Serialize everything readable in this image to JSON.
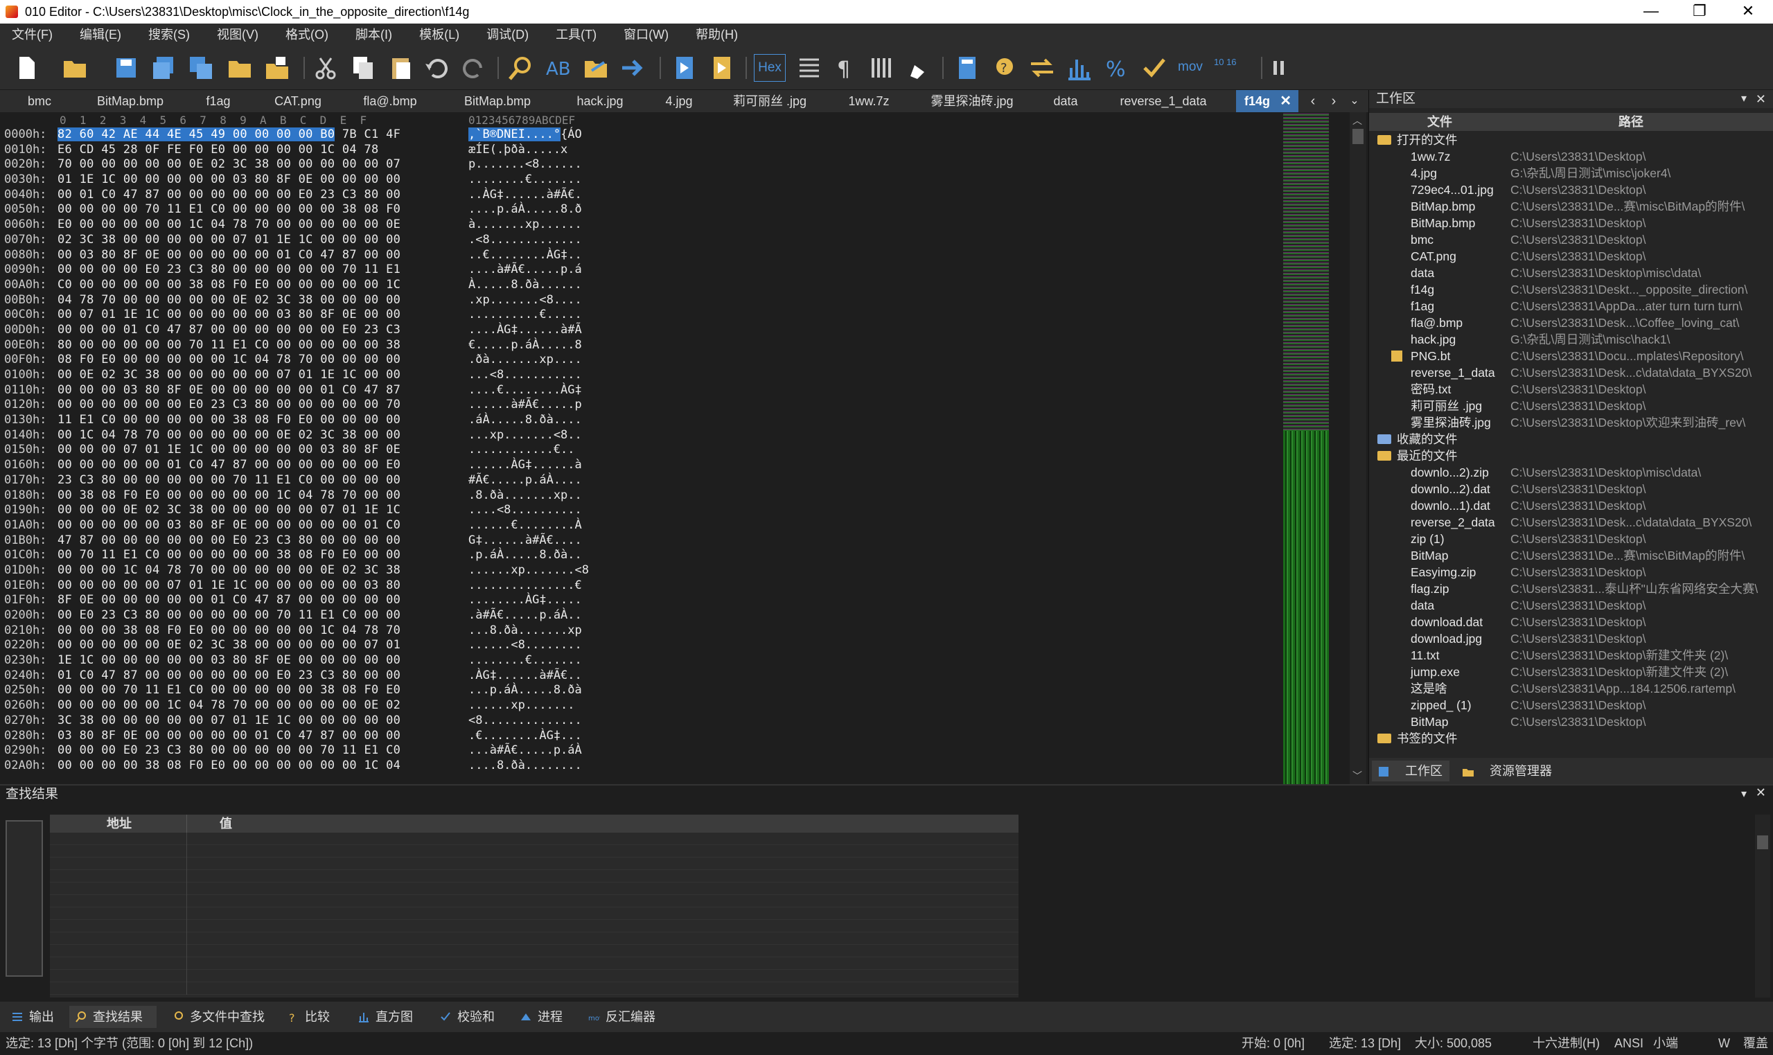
{
  "window": {
    "title": "010 Editor - C:\\Users\\23831\\Desktop\\misc\\Clock_in_the_opposite_direction\\f14g",
    "minimize": "—",
    "maximize": "❐",
    "close": "✕"
  },
  "menu": [
    "文件(F)",
    "编辑(E)",
    "搜索(S)",
    "视图(V)",
    "格式(O)",
    "脚本(I)",
    "模板(L)",
    "调试(D)",
    "工具(T)",
    "窗口(W)",
    "帮助(H)"
  ],
  "toolbar": {
    "hex_label": "Hex",
    "mov_label": "mov",
    "base_label": "10 16"
  },
  "tabs": [
    "bmc",
    "BitMap.bmp",
    "f1ag",
    "CAT.png",
    "fla@.bmp",
    "BitMap.bmp",
    "hack.jpg",
    "4.jpg",
    "莉可丽丝 .jpg",
    "1ww.7z",
    "雾里探油砖.jpg",
    "data",
    "reverse_1_data",
    "f14g"
  ],
  "active_tab": "f14g",
  "hex_header": {
    "cols": "0  1  2  3  4  5  6  7  8  9  A  B  C  D  E  F",
    "ascii": "0123456789ABCDEF"
  },
  "hex_rows": [
    {
      "a": "0000h:",
      "b": "82 60 42 AE 44 4E 45 49 00 00 00 00 B0 7B C1 4F",
      "t": "‚`B®DNEI....°{ÁO"
    },
    {
      "a": "0010h:",
      "b": "E6 CD 45 28 0F FE F0 E0 00 00 00 00 1C 04 78",
      "t": "æÍE(.þðà.....x"
    },
    {
      "a": "0020h:",
      "b": "70 00 00 00 00 00 0E 02 3C 38 00 00 00 00 00 07",
      "t": "p.......<8......"
    },
    {
      "a": "0030h:",
      "b": "01 1E 1C 00 00 00 00 00 03 80 8F 0E 00 00 00 00",
      "t": "........€......."
    },
    {
      "a": "0040h:",
      "b": "00 01 C0 47 87 00 00 00 00 00 00 E0 23 C3 80 00",
      "t": "..ÀG‡......à#Ã€."
    },
    {
      "a": "0050h:",
      "b": "00 00 00 00 70 11 E1 C0 00 00 00 00 00 38 08 F0",
      "t": "....p.áÀ.....8.ð"
    },
    {
      "a": "0060h:",
      "b": "E0 00 00 00 00 00 1C 04 78 70 00 00 00 00 00 0E",
      "t": "à.......xp......"
    },
    {
      "a": "0070h:",
      "b": "02 3C 38 00 00 00 00 00 07 01 1E 1C 00 00 00 00",
      "t": ".<8............."
    },
    {
      "a": "0080h:",
      "b": "00 03 80 8F 0E 00 00 00 00 00 01 C0 47 87 00 00",
      "t": "..€........ÀG‡.."
    },
    {
      "a": "0090h:",
      "b": "00 00 00 00 E0 23 C3 80 00 00 00 00 00 70 11 E1",
      "t": "....à#Ã€.....p.á"
    },
    {
      "a": "00A0h:",
      "b": "C0 00 00 00 00 00 38 08 F0 E0 00 00 00 00 00 1C",
      "t": "À.....8.ðà......"
    },
    {
      "a": "00B0h:",
      "b": "04 78 70 00 00 00 00 00 0E 02 3C 38 00 00 00 00",
      "t": ".xp.......<8...."
    },
    {
      "a": "00C0h:",
      "b": "00 07 01 1E 1C 00 00 00 00 00 03 80 8F 0E 00 00",
      "t": "..........€....."
    },
    {
      "a": "00D0h:",
      "b": "00 00 00 01 C0 47 87 00 00 00 00 00 00 E0 23 C3",
      "t": "....ÀG‡......à#Ã"
    },
    {
      "a": "00E0h:",
      "b": "80 00 00 00 00 00 70 11 E1 C0 00 00 00 00 00 38",
      "t": "€.....p.áÀ.....8"
    },
    {
      "a": "00F0h:",
      "b": "08 F0 E0 00 00 00 00 00 1C 04 78 70 00 00 00 00",
      "t": ".ðà.......xp...."
    },
    {
      "a": "0100h:",
      "b": "00 0E 02 3C 38 00 00 00 00 00 07 01 1E 1C 00 00",
      "t": "...<8..........."
    },
    {
      "a": "0110h:",
      "b": "00 00 00 03 80 8F 0E 00 00 00 00 00 01 C0 47 87",
      "t": "....€........ÀG‡"
    },
    {
      "a": "0120h:",
      "b": "00 00 00 00 00 00 E0 23 C3 80 00 00 00 00 00 70",
      "t": "......à#Ã€.....p"
    },
    {
      "a": "0130h:",
      "b": "11 E1 C0 00 00 00 00 00 38 08 F0 E0 00 00 00 00",
      "t": ".áÀ.....8.ðà...."
    },
    {
      "a": "0140h:",
      "b": "00 1C 04 78 70 00 00 00 00 00 0E 02 3C 38 00 00",
      "t": "...xp.......<8.."
    },
    {
      "a": "0150h:",
      "b": "00 00 00 07 01 1E 1C 00 00 00 00 00 03 80 8F 0E",
      "t": "............€.."
    },
    {
      "a": "0160h:",
      "b": "00 00 00 00 00 01 C0 47 87 00 00 00 00 00 00 E0",
      "t": "......ÀG‡......à"
    },
    {
      "a": "0170h:",
      "b": "23 C3 80 00 00 00 00 00 70 11 E1 C0 00 00 00 00",
      "t": "#Ã€.....p.áÀ...."
    },
    {
      "a": "0180h:",
      "b": "00 38 08 F0 E0 00 00 00 00 00 1C 04 78 70 00 00",
      "t": ".8.ðà.......xp.."
    },
    {
      "a": "0190h:",
      "b": "00 00 00 0E 02 3C 38 00 00 00 00 00 07 01 1E 1C",
      "t": "....<8.........."
    },
    {
      "a": "01A0h:",
      "b": "00 00 00 00 00 03 80 8F 0E 00 00 00 00 00 01 C0",
      "t": "......€........À"
    },
    {
      "a": "01B0h:",
      "b": "47 87 00 00 00 00 00 00 E0 23 C3 80 00 00 00 00",
      "t": "G‡......à#Ã€...."
    },
    {
      "a": "01C0h:",
      "b": "00 70 11 E1 C0 00 00 00 00 00 38 08 F0 E0 00 00",
      "t": ".p.áÀ.....8.ðà.."
    },
    {
      "a": "01D0h:",
      "b": "00 00 00 1C 04 78 70 00 00 00 00 00 0E 02 3C 38",
      "t": "......xp.......<8"
    },
    {
      "a": "01E0h:",
      "b": "00 00 00 00 00 07 01 1E 1C 00 00 00 00 00 03 80",
      "t": "...............€"
    },
    {
      "a": "01F0h:",
      "b": "8F 0E 00 00 00 00 00 01 C0 47 87 00 00 00 00 00",
      "t": "........ÀG‡....."
    },
    {
      "a": "0200h:",
      "b": "00 E0 23 C3 80 00 00 00 00 00 70 11 E1 C0 00 00",
      "t": ".à#Ã€.....p.áÀ.."
    },
    {
      "a": "0210h:",
      "b": "00 00 00 38 08 F0 E0 00 00 00 00 00 1C 04 78 70",
      "t": "...8.ðà.......xp"
    },
    {
      "a": "0220h:",
      "b": "00 00 00 00 00 0E 02 3C 38 00 00 00 00 00 07 01",
      "t": "......<8........"
    },
    {
      "a": "0230h:",
      "b": "1E 1C 00 00 00 00 00 03 80 8F 0E 00 00 00 00 00",
      "t": "........€......."
    },
    {
      "a": "0240h:",
      "b": "01 C0 47 87 00 00 00 00 00 00 E0 23 C3 80 00 00",
      "t": ".ÀG‡......à#Ã€.."
    },
    {
      "a": "0250h:",
      "b": "00 00 00 70 11 E1 C0 00 00 00 00 00 38 08 F0 E0",
      "t": "...p.áÀ.....8.ðà"
    },
    {
      "a": "0260h:",
      "b": "00 00 00 00 00 1C 04 78 70 00 00 00 00 00 0E 02",
      "t": "......xp......."
    },
    {
      "a": "0270h:",
      "b": "3C 38 00 00 00 00 00 07 01 1E 1C 00 00 00 00 00",
      "t": "<8.............."
    },
    {
      "a": "0280h:",
      "b": "03 80 8F 0E 00 00 00 00 00 01 C0 47 87 00 00 00",
      "t": ".€........ÀG‡..."
    },
    {
      "a": "0290h:",
      "b": "00 00 00 E0 23 C3 80 00 00 00 00 00 70 11 E1 C0",
      "t": "...à#Ã€.....p.áÀ"
    },
    {
      "a": "02A0h:",
      "b": "00 00 00 00 38 08 F0 E0 00 00 00 00 00 00 1C 04",
      "t": "....8.ðà........"
    }
  ],
  "selection": {
    "bytes": "82 60 42 AE 44 4E 45 49 00 00 00 00 B0",
    "ascii": "‚`B®DNEI....°"
  },
  "workspace": {
    "title": "工作区",
    "col_file": "文件",
    "col_path": "路径",
    "groups": {
      "open": "打开的文件",
      "fav": "收藏的文件",
      "recent": "最近的文件",
      "bookmark": "书签的文件"
    },
    "open_files": [
      {
        "n": "1ww.7z",
        "p": "C:\\Users\\23831\\Desktop\\"
      },
      {
        "n": "4.jpg",
        "p": "G:\\杂乱\\周日测试\\misc\\joker4\\"
      },
      {
        "n": "729ec4...01.jpg",
        "p": "C:\\Users\\23831\\Desktop\\"
      },
      {
        "n": "BitMap.bmp",
        "p": "C:\\Users\\23831\\De...赛\\misc\\BitMap的附件\\"
      },
      {
        "n": "BitMap.bmp",
        "p": "C:\\Users\\23831\\Desktop\\"
      },
      {
        "n": "bmc",
        "p": "C:\\Users\\23831\\Desktop\\"
      },
      {
        "n": "CAT.png",
        "p": "C:\\Users\\23831\\Desktop\\"
      },
      {
        "n": "data",
        "p": "C:\\Users\\23831\\Desktop\\misc\\data\\"
      },
      {
        "n": "f14g",
        "p": "C:\\Users\\23831\\Deskt..._opposite_direction\\"
      },
      {
        "n": "f1ag",
        "p": "C:\\Users\\23831\\AppDa...ater turn turn turn\\"
      },
      {
        "n": "fla@.bmp",
        "p": "C:\\Users\\23831\\Desk...\\Coffee_loving_cat\\"
      },
      {
        "n": "hack.jpg",
        "p": "G:\\杂乱\\周日测试\\misc\\hack1\\"
      },
      {
        "n": "PNG.bt",
        "p": "C:\\Users\\23831\\Docu...mplates\\Repository\\"
      },
      {
        "n": "reverse_1_data",
        "p": "C:\\Users\\23831\\Desk...c\\data\\data_BYXS20\\"
      },
      {
        "n": "密码.txt",
        "p": "C:\\Users\\23831\\Desktop\\"
      },
      {
        "n": "莉可丽丝 .jpg",
        "p": "C:\\Users\\23831\\Desktop\\"
      },
      {
        "n": "雾里探油砖.jpg",
        "p": "C:\\Users\\23831\\Desktop\\欢迎来到油砖_rev\\"
      }
    ],
    "recent_files": [
      {
        "n": "downlo...2).zip",
        "p": "C:\\Users\\23831\\Desktop\\misc\\data\\"
      },
      {
        "n": "downlo...2).dat",
        "p": "C:\\Users\\23831\\Desktop\\"
      },
      {
        "n": "downlo...1).dat",
        "p": "C:\\Users\\23831\\Desktop\\"
      },
      {
        "n": "reverse_2_data",
        "p": "C:\\Users\\23831\\Desk...c\\data\\data_BYXS20\\"
      },
      {
        "n": "zip (1)",
        "p": "C:\\Users\\23831\\Desktop\\"
      },
      {
        "n": "BitMap",
        "p": "C:\\Users\\23831\\De...赛\\misc\\BitMap的附件\\"
      },
      {
        "n": "Easyimg.zip",
        "p": "C:\\Users\\23831\\Desktop\\"
      },
      {
        "n": "flag.zip",
        "p": "C:\\Users\\23831...泰山杯\"山东省网络安全大赛\\"
      },
      {
        "n": "data",
        "p": "C:\\Users\\23831\\Desktop\\"
      },
      {
        "n": "download.dat",
        "p": "C:\\Users\\23831\\Desktop\\"
      },
      {
        "n": "download.jpg",
        "p": "C:\\Users\\23831\\Desktop\\"
      },
      {
        "n": "11.txt",
        "p": "C:\\Users\\23831\\Desktop\\新建文件夹 (2)\\"
      },
      {
        "n": "jump.exe",
        "p": "C:\\Users\\23831\\Desktop\\新建文件夹 (2)\\"
      },
      {
        "n": "这是啥",
        "p": "C:\\Users\\23831\\App...184.12506.rartemp\\"
      },
      {
        "n": "zipped_ (1)",
        "p": "C:\\Users\\23831\\Desktop\\"
      },
      {
        "n": "BitMap",
        "p": "C:\\Users\\23831\\Desktop\\"
      }
    ],
    "tabs": [
      "工作区",
      "资源管理器"
    ]
  },
  "find": {
    "title": "查找结果",
    "col_addr": "地址",
    "col_val": "值"
  },
  "bottom_tabs": [
    "输出",
    "查找结果",
    "多文件中查找",
    "比较",
    "直方图",
    "校验和",
    "进程",
    "反汇编器"
  ],
  "status": {
    "left": "选定: 13 [Dh] 个字节 (范围: 0 [0h] 到 12 [Ch])",
    "start": "开始: 0 [0h]",
    "selected": "选定: 13 [Dh]",
    "size": "大小: 500,085",
    "mode": "十六进制(H)",
    "enc": "ANSI",
    "endian": "小端",
    "w": "W",
    "ovr": "覆盖"
  },
  "colors": {
    "accent": "#2f76c8",
    "bg": "#1e1e1e",
    "panel": "#2d2d2d"
  }
}
